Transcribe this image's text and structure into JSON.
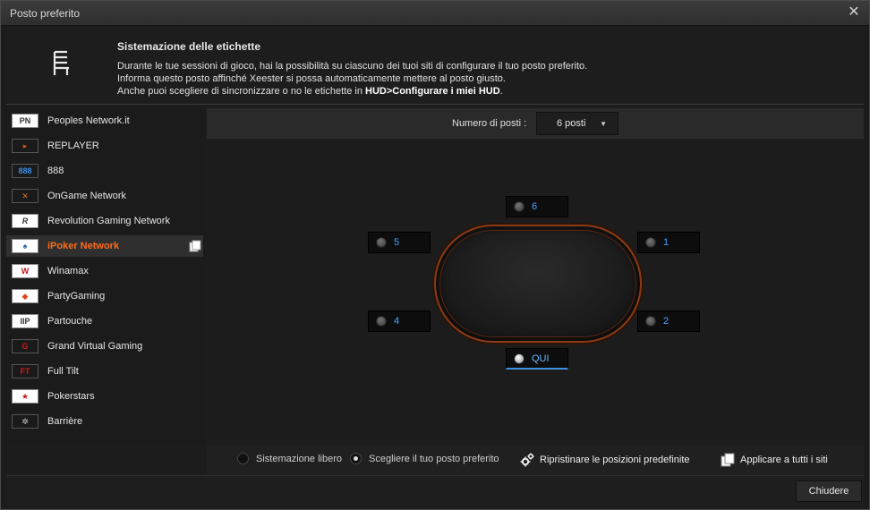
{
  "window": {
    "title": "Posto preferito",
    "close_glyph": "✕"
  },
  "header": {
    "title": "Sistemazione delle etichette",
    "line1": "Durante le tue sessioni di gioco, hai la possibilità su ciascuno dei tuoi siti di configurare il tuo posto preferito.",
    "line2": "Informa questo posto affinché Xeester si possa automaticamente mettere al posto giusto.",
    "line3_prefix": "Anche puoi scegliere di sincronizzare o no le etichette in ",
    "line3_bold": "HUD>Configurare i miei HUD",
    "line3_suffix": "."
  },
  "sites": [
    {
      "label": "Peoples Network.it",
      "logo": "PN"
    },
    {
      "label": "REPLAYER",
      "logo": "▸"
    },
    {
      "label": "888",
      "logo": "888"
    },
    {
      "label": "OnGame Network",
      "logo": "✕"
    },
    {
      "label": "Revolution Gaming Network",
      "logo": "R"
    },
    {
      "label": "iPoker Network",
      "logo": "♠"
    },
    {
      "label": "Winamax",
      "logo": "W"
    },
    {
      "label": "PartyGaming",
      "logo": "◆"
    },
    {
      "label": "Partouche",
      "logo": "IIP"
    },
    {
      "label": "Grand Virtual Gaming",
      "logo": "G"
    },
    {
      "label": "Full Tilt",
      "logo": "FT"
    },
    {
      "label": "Pokerstars",
      "logo": "★"
    },
    {
      "label": "Barrière",
      "logo": "✲"
    }
  ],
  "active_site_index": 5,
  "seats_control": {
    "label": "Numero di posti :",
    "value": "6 posti",
    "caret": "▼"
  },
  "seats": {
    "s6": "6",
    "s5": "5",
    "s1": "1",
    "s4": "4",
    "s2": "2",
    "me": "QUI"
  },
  "bottom": {
    "radio_free": "Sistemazione libero",
    "radio_preferred": "Scegliere il tuo posto preferito",
    "restore": "Ripristinare le posizioni predefinite",
    "apply_all": "Applicare a tutti i siti"
  },
  "footer": {
    "close_label": "Chiudere"
  }
}
